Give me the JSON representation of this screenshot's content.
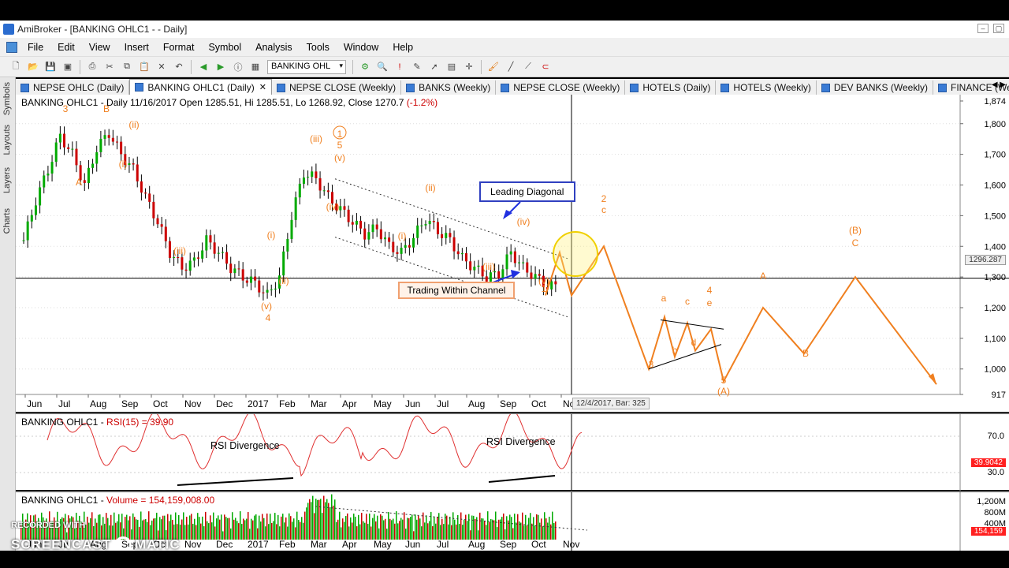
{
  "window": {
    "title": "AmiBroker - [BANKING OHLC1 -  - Daily]"
  },
  "menu": [
    "File",
    "Edit",
    "View",
    "Insert",
    "Format",
    "Symbol",
    "Analysis",
    "Tools",
    "Window",
    "Help"
  ],
  "toolbar": {
    "symbol_value": "BANKING OHL"
  },
  "tabs": [
    {
      "label": "NEPSE OHLC (Daily)",
      "active": false
    },
    {
      "label": "BANKING OHLC1 (Daily)",
      "active": true
    },
    {
      "label": "NEPSE CLOSE (Weekly)",
      "active": false
    },
    {
      "label": "BANKS (Weekly)",
      "active": false
    },
    {
      "label": "NEPSE CLOSE (Weekly)",
      "active": false
    },
    {
      "label": "HOTELS (Daily)",
      "active": false
    },
    {
      "label": "HOTELS (Weekly)",
      "active": false
    },
    {
      "label": "DEV BANKS (Weekly)",
      "active": false
    },
    {
      "label": "FINANCE (Weekly)",
      "active": false
    }
  ],
  "sidebar": [
    "Symbols",
    "Layouts",
    "Layers",
    "Charts"
  ],
  "main": {
    "header_prefix": "BANKING OHLC1 - Daily 11/16/2017 Open 1285.51, Hi 1285.51, Lo 1268.92, Close 1270.7 ",
    "header_change": "(-1.2%)",
    "price_marker": "1296.287",
    "date_readout": "12/4/2017, Bar: 325",
    "callout_diagonal": "Leading Diagonal",
    "callout_channel": "Trading Within Channel"
  },
  "rsi": {
    "header_prefix": "BANKING OHLC1 - ",
    "header_value": "RSI(15) = 39.90",
    "label_left": "RSI Divergence",
    "label_right": "RSI Divergence",
    "value_marker": "39.9042",
    "axis": [
      "70.0",
      "30.0"
    ]
  },
  "volume": {
    "header_prefix": "BANKING OHLC1 - ",
    "header_value": "Volume = 154,159,008.00",
    "value_marker": "154,159",
    "axis": [
      "1,200M",
      "800M",
      "400M"
    ]
  },
  "watermark": {
    "line1": "RECORDED WITH",
    "line2a": "SCREENCAST",
    "line2b": "MATIC"
  },
  "chart_data": {
    "type": "candlestick",
    "title": "BANKING OHLC1 - Daily",
    "y_ticks": [
      1874,
      1800,
      1700,
      1600,
      1500,
      1400,
      1300,
      1200,
      1100,
      1000,
      917
    ],
    "ylim": [
      917,
      1874
    ],
    "x_ticks": [
      "Jun",
      "Jul",
      "Aug",
      "Sep",
      "Oct",
      "Nov",
      "Dec",
      "2017",
      "Feb",
      "Mar",
      "Apr",
      "May",
      "Jun",
      "Jul",
      "Aug",
      "Sep",
      "Oct",
      "Nov"
    ],
    "close_path": [
      1420,
      1550,
      1650,
      1760,
      1700,
      1600,
      1720,
      1770,
      1700,
      1650,
      1560,
      1480,
      1380,
      1330,
      1350,
      1420,
      1380,
      1330,
      1300,
      1280,
      1240,
      1300,
      1500,
      1640,
      1620,
      1560,
      1520,
      1480,
      1440,
      1460,
      1400,
      1380,
      1430,
      1490,
      1450,
      1420,
      1360,
      1330,
      1300,
      1310,
      1380,
      1330,
      1300,
      1270
    ],
    "projection": [
      {
        "x": "2017-12",
        "y": 1240
      },
      {
        "x": "2017-12",
        "y": 1400
      },
      {
        "x": "2018-01",
        "y": 1000
      },
      {
        "x": "2018-01",
        "y": 1170
      },
      {
        "x": "2018-01",
        "y": 1040
      },
      {
        "x": "2018-01",
        "y": 1150
      },
      {
        "x": "2018-02",
        "y": 1060
      },
      {
        "x": "2018-02",
        "y": 1130
      },
      {
        "x": "2018-02",
        "y": 960
      },
      {
        "x": "2018-03",
        "y": 1200
      },
      {
        "x": "2018-03",
        "y": 1050
      },
      {
        "x": "2018-04",
        "y": 1300
      },
      {
        "x": "2018-05",
        "y": 950
      }
    ],
    "wave_labels": [
      "3",
      "B",
      "(ii)",
      "A",
      "(i)",
      "(iii)",
      "(i)",
      "(ii)",
      "(v)",
      "4",
      "(iii)",
      "1",
      "5",
      "(v)",
      "(iv)",
      "(ii)",
      "(i)",
      "(iv)",
      "(iii)",
      "(v)",
      "1",
      "2",
      "c",
      "a",
      "b",
      "c",
      "d",
      "4",
      "e",
      "3",
      "5",
      "(A)",
      "A",
      "B",
      "(B)",
      "C"
    ],
    "annotations": [
      "Leading Diagonal",
      "Trading Within Channel"
    ]
  }
}
